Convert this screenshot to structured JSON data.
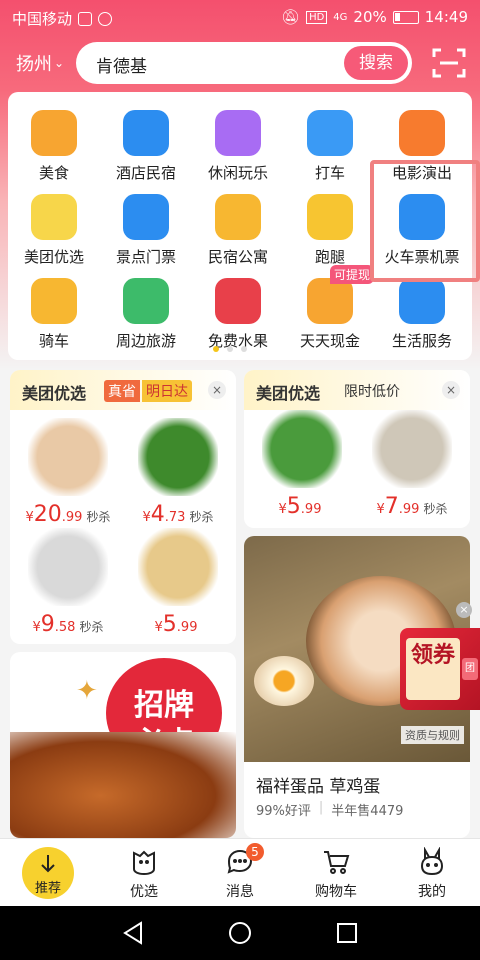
{
  "status_bar": {
    "carrier": "中国移动",
    "hd": "HD",
    "signal": "4G",
    "battery": "20%",
    "time": "14:49"
  },
  "header": {
    "city": "扬州",
    "search_value": "肯德基",
    "search_button": "搜索"
  },
  "categories": [
    {
      "label": "美食",
      "icon": "food-icon",
      "color": "#f7a531"
    },
    {
      "label": "酒店民宿",
      "icon": "hotel-icon",
      "color": "#2c8df0"
    },
    {
      "label": "休闲玩乐",
      "icon": "leisure-icon",
      "color": "#a86cf3"
    },
    {
      "label": "打车",
      "icon": "taxi-icon",
      "color": "#3a9af5"
    },
    {
      "label": "电影演出",
      "icon": "movie-icon",
      "color": "#f77b2e"
    },
    {
      "label": "美团优选",
      "icon": "youxuan-icon",
      "color": "#f7d64a"
    },
    {
      "label": "景点门票",
      "icon": "attraction-icon",
      "color": "#2c8df0"
    },
    {
      "label": "民宿公寓",
      "icon": "apartment-icon",
      "color": "#f7b731"
    },
    {
      "label": "跑腿",
      "icon": "errand-icon",
      "color": "#f7c531"
    },
    {
      "label": "火车票机票",
      "icon": "train-plane-icon",
      "color": "#2c8df0"
    },
    {
      "label": "骑车",
      "icon": "bike-icon",
      "color": "#f7b731"
    },
    {
      "label": "周边旅游",
      "icon": "travel-icon",
      "color": "#3dbb6a"
    },
    {
      "label": "免费水果",
      "icon": "fruit-icon",
      "color": "#e8404a"
    },
    {
      "label": "天天现金",
      "icon": "cash-icon",
      "color": "#f7a531"
    },
    {
      "label": "生活服务",
      "icon": "service-icon",
      "color": "#2c8df0"
    }
  ],
  "cash_tag": "可提现",
  "card_youxuan": {
    "title": "美团优选",
    "badge": "真省",
    "badge2": "明日达",
    "close": "×",
    "products": [
      {
        "icon": "eggs-icon",
        "int": "20",
        "dec": ".99",
        "flash": "秒杀",
        "color": "#e9c9a6"
      },
      {
        "icon": "broccoli-icon",
        "int": "4",
        "dec": ".73",
        "flash": "秒杀",
        "color": "#3e8a2c"
      },
      {
        "icon": "shrimp-icon",
        "int": "9",
        "dec": ".58",
        "flash": "秒杀",
        "color": "#d9d9d9"
      },
      {
        "icon": "ginger-icon",
        "int": "5",
        "dec": ".99",
        "flash": "",
        "color": "#e7c98a"
      }
    ],
    "currency": "¥"
  },
  "card_limited": {
    "title": "美团优选",
    "subtitle": "限时低价",
    "close": "×",
    "products": [
      {
        "icon": "greens-icon",
        "int": "5",
        "dec": ".99",
        "flash": "",
        "color": "#4a9b3c"
      },
      {
        "icon": "small-shrimp-icon",
        "int": "7",
        "dec": ".99",
        "flash": "秒杀",
        "color": "#cfc7b8"
      }
    ],
    "currency": "¥"
  },
  "promo_card": {
    "line1": "招牌",
    "line2": "必点"
  },
  "egg_card": {
    "title": "福祥蛋品 草鸡蛋",
    "rating": "99%好评",
    "sales": "半年售4479",
    "qual": "资质与规则",
    "coupon": "领券",
    "coupon_side": "团"
  },
  "nav": [
    {
      "label": "推荐",
      "icon": "arrow-down-icon",
      "badge": ""
    },
    {
      "label": "优选",
      "icon": "youxuan-icon",
      "badge": ""
    },
    {
      "label": "消息",
      "icon": "message-icon",
      "badge": "5"
    },
    {
      "label": "购物车",
      "icon": "cart-icon",
      "badge": ""
    },
    {
      "label": "我的",
      "icon": "profile-icon",
      "badge": ""
    }
  ]
}
